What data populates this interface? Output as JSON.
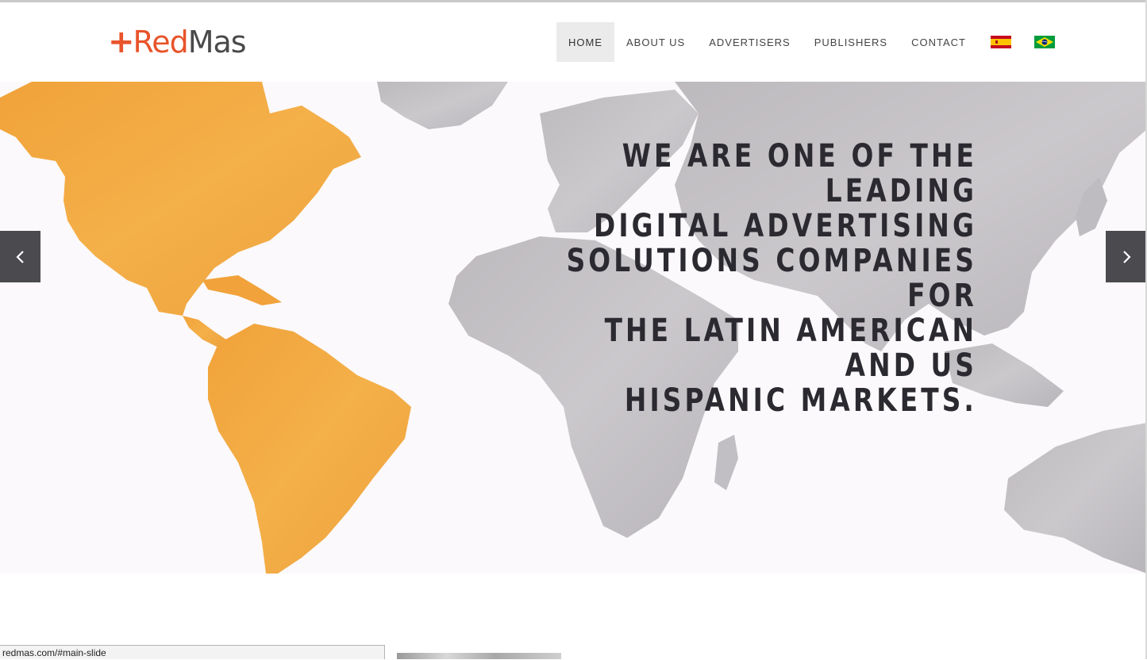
{
  "header": {
    "logo": {
      "plus": "+",
      "red": "Red",
      "mas": "Mas"
    },
    "nav": [
      {
        "label": "HOME",
        "active": true
      },
      {
        "label": "ABOUT US",
        "active": false
      },
      {
        "label": "ADVERTISERS",
        "active": false
      },
      {
        "label": "PUBLISHERS",
        "active": false
      },
      {
        "label": "CONTACT",
        "active": false
      }
    ],
    "flags": [
      "spain-flag-icon",
      "brazil-flag-icon"
    ]
  },
  "hero": {
    "headline_lines": [
      "WE ARE ONE OF THE LEADING",
      "DIGITAL ADVERTISING",
      "SOLUTIONS COMPANIES FOR",
      "THE LATIN AMERICAN AND US",
      "HISPANIC MARKETS."
    ],
    "prev_icon": "chevron-left-icon",
    "next_icon": "chevron-right-icon",
    "colors": {
      "americas": "#f2a63b",
      "world": "#c8c4c9",
      "text": "#2b2a30"
    }
  },
  "status_bar": {
    "url": "redmas.com/#main-slide"
  }
}
